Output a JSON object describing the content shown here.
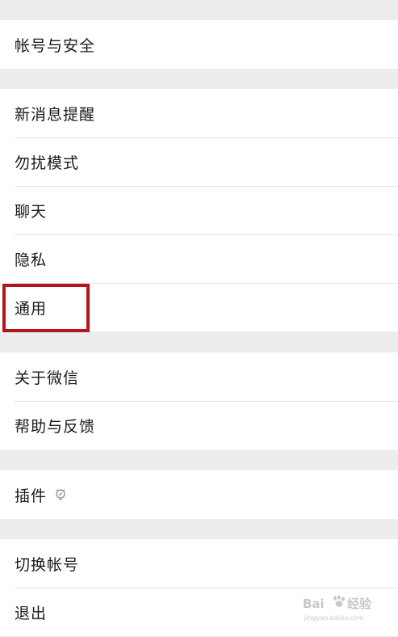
{
  "groups": [
    {
      "items": [
        {
          "label": "帐号与安全"
        }
      ]
    },
    {
      "items": [
        {
          "label": "新消息提醒"
        },
        {
          "label": "勿扰模式"
        },
        {
          "label": "聊天"
        },
        {
          "label": "隐私"
        },
        {
          "label": "通用"
        }
      ]
    },
    {
      "items": [
        {
          "label": "关于微信"
        },
        {
          "label": "帮助与反馈"
        }
      ]
    },
    {
      "items": [
        {
          "label": "插件",
          "icon": "lightbulb-icon"
        }
      ]
    },
    {
      "items": [
        {
          "label": "切换帐号"
        },
        {
          "label": "退出"
        }
      ]
    }
  ],
  "highlight": {
    "target": "通用",
    "color": "#b4141a"
  },
  "watermark": {
    "brand": "Bai",
    "brand_suffix": "经验",
    "url": "jingyan.baidu.com"
  },
  "colors": {
    "background": "#ededed",
    "row_background": "#ffffff",
    "divider": "#e3e3e3",
    "text": "#1a1a1a"
  }
}
